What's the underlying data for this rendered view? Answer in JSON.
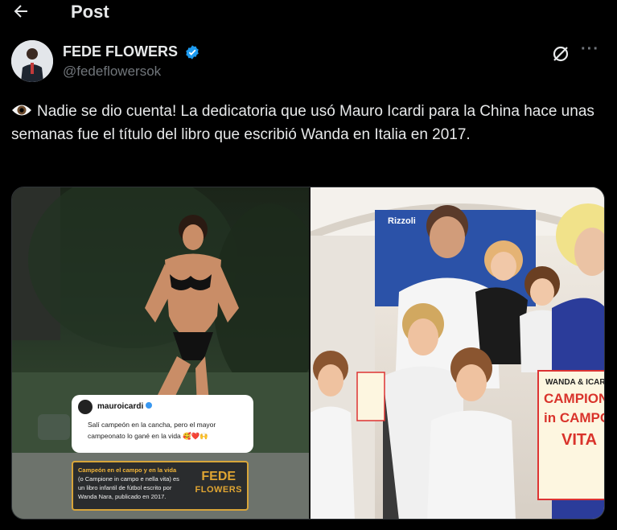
{
  "header": {
    "back_icon": "arrow-left-icon",
    "title": "Post"
  },
  "author": {
    "display_name": "FEDE FLOWERS",
    "handle": "@fedeflowersok",
    "verified_color": "#1d9bf0"
  },
  "post": {
    "text": "Nadie se dio cuenta!  La dedicatoria que usó Mauro Icardi para la China hace unas semanas fue el título del libro que escribió Wanda en Italia en 2017."
  },
  "media": {
    "left": {
      "ig_user": "mauroicardi",
      "ig_comment": "Salí campeón en la cancha, pero el mayor campeonato lo gané en la vida 🥰❤️🙌",
      "caption_highlight": "Campeón en el campo y en la vida",
      "caption_rest": " (o Campione in campo e nella vita) es un libro infantil de fútbol escrito por Wanda Nara, publicado en 2017.",
      "logo_line1": "FEDE",
      "logo_line2": "FLOWERS"
    },
    "right": {
      "sign_brand": "Rizzoli",
      "book_title_top": "WANDA & ICARDI",
      "book_title_main": "CAMPIONE",
      "book_title_sub": "in CAMPO",
      "book_title_end": "VITA"
    }
  },
  "colors": {
    "background": "#000000",
    "text": "#e7e9ea",
    "muted": "#71767b",
    "accent": "#1d9bf0"
  }
}
